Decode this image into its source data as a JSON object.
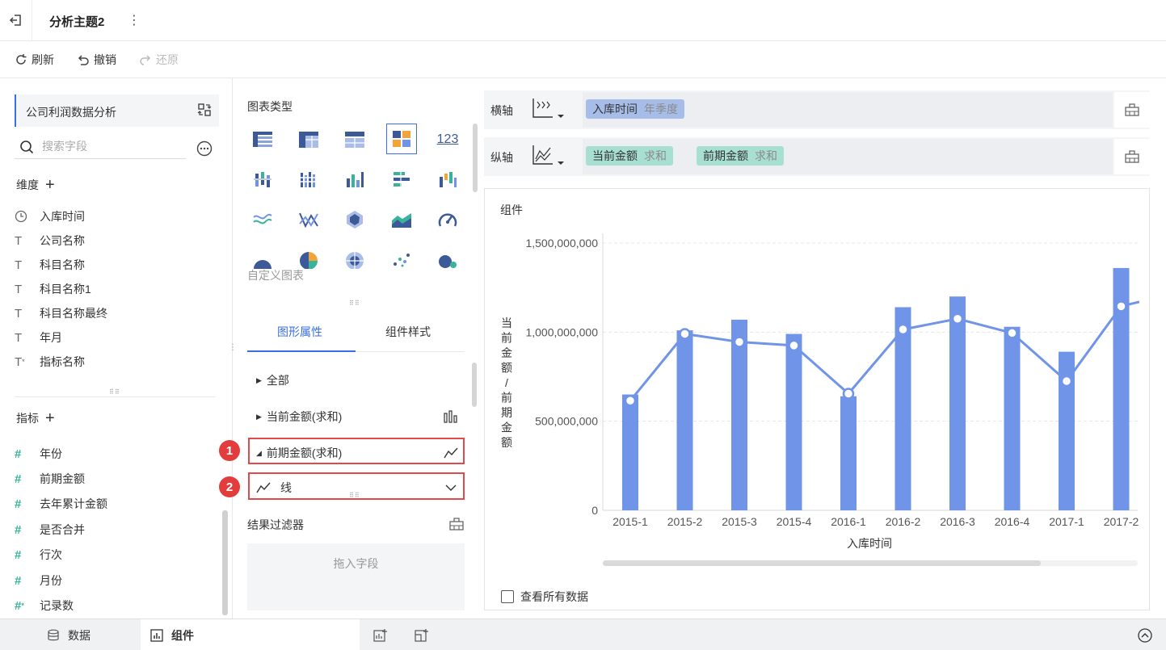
{
  "topbar": {
    "title": "分析主题2"
  },
  "toolbar": {
    "refresh": "刷新",
    "undo": "撤销",
    "redo": "还原"
  },
  "left": {
    "dataset": "公司利润数据分析",
    "search_placeholder": "搜索字段",
    "dimensions_title": "维度",
    "dimensions": [
      {
        "icon": "clock-icon",
        "label": "入库时间"
      },
      {
        "icon": "text-icon",
        "label": "公司名称"
      },
      {
        "icon": "text-icon",
        "label": "科目名称"
      },
      {
        "icon": "text-icon",
        "label": "科目名称1"
      },
      {
        "icon": "text-icon",
        "label": "科目名称最终"
      },
      {
        "icon": "text-icon",
        "label": "年月"
      },
      {
        "icon": "text-calc-icon",
        "label": "指标名称"
      }
    ],
    "metrics_title": "指标",
    "metrics": [
      {
        "icon": "hash-icon",
        "label": "年份"
      },
      {
        "icon": "hash-icon",
        "label": "前期金额"
      },
      {
        "icon": "hash-icon",
        "label": "去年累计金额"
      },
      {
        "icon": "hash-icon",
        "label": "是否合并"
      },
      {
        "icon": "hash-icon",
        "label": "行次"
      },
      {
        "icon": "hash-icon",
        "label": "月份"
      },
      {
        "icon": "hash-calc-icon",
        "label": "记录数"
      }
    ]
  },
  "middle": {
    "chart_type_title": "图表类型",
    "number_icon_text": "123",
    "custom_chart": "自定义图表",
    "tabs": [
      "图形属性",
      "组件样式"
    ],
    "props": {
      "all": "全部",
      "current": "当前金额(求和)",
      "previous": "前期金额(求和)",
      "line_type": "线"
    },
    "badges": [
      "1",
      "2"
    ],
    "filter_title": "结果过滤器",
    "filter_placeholder": "拖入字段"
  },
  "axes": {
    "x_label": "横轴",
    "y_label": "纵轴",
    "x_fields": [
      {
        "name": "入库时间",
        "agg": "年季度"
      }
    ],
    "y_fields": [
      {
        "name": "当前金额",
        "agg": "求和"
      },
      {
        "name": "前期金额",
        "agg": "求和"
      }
    ]
  },
  "chart_panel": {
    "title": "组件",
    "show_all": "查看所有数据"
  },
  "chart_data": {
    "type": "bar",
    "categories": [
      "2015-1",
      "2015-2",
      "2015-3",
      "2015-4",
      "2016-1",
      "2016-2",
      "2016-3",
      "2016-4",
      "2017-1",
      "2017-2"
    ],
    "series": [
      {
        "name": "当前金额",
        "type": "bar",
        "values": [
          650000000,
          1010000000,
          1070000000,
          990000000,
          640000000,
          1140000000,
          1200000000,
          1030000000,
          890000000,
          1360000000
        ]
      },
      {
        "name": "前期金额",
        "type": "line",
        "values": [
          615000000,
          990000000,
          945000000,
          925000000,
          655000000,
          1015000000,
          1075000000,
          995000000,
          725000000,
          1145000000
        ]
      }
    ],
    "y_ticks": [
      "0",
      "500,000,000",
      "1,000,000,000",
      "1,500,000,000"
    ],
    "y_tick_values": [
      0,
      500000000,
      1000000000,
      1500000000
    ],
    "ylim": [
      0,
      1500000000
    ],
    "xlabel": "入库时间",
    "ylabel": "当前金额/前期金额",
    "grid": true,
    "colors": {
      "bar": "#6f94e8",
      "line": "#6f94e8"
    }
  },
  "bottombar": {
    "data_tab": "数据",
    "component_tab": "组件"
  }
}
